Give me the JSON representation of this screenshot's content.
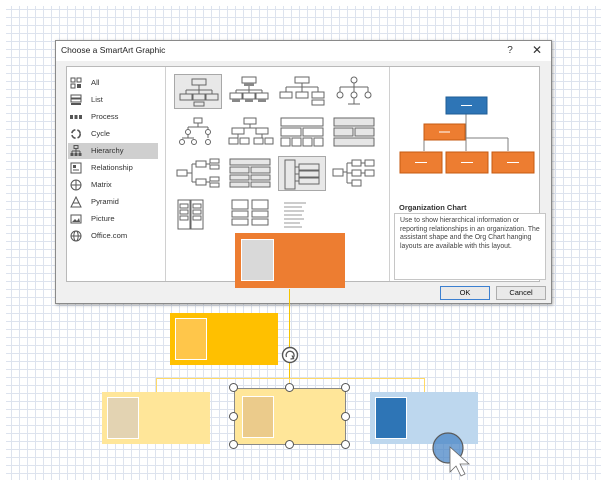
{
  "dialog": {
    "title": "Choose a SmartArt Graphic",
    "help_label": "?",
    "close_label": "✕",
    "ok_label": "OK",
    "cancel_label": "Cancel"
  },
  "categories": [
    {
      "label": "All",
      "icon": "grid-all-icon"
    },
    {
      "label": "List",
      "icon": "list-icon"
    },
    {
      "label": "Process",
      "icon": "process-icon"
    },
    {
      "label": "Cycle",
      "icon": "cycle-icon"
    },
    {
      "label": "Hierarchy",
      "icon": "hierarchy-icon",
      "selected": true
    },
    {
      "label": "Relationship",
      "icon": "relationship-icon"
    },
    {
      "label": "Matrix",
      "icon": "matrix-icon"
    },
    {
      "label": "Pyramid",
      "icon": "pyramid-icon"
    },
    {
      "label": "Picture",
      "icon": "picture-icon"
    },
    {
      "label": "Office.com",
      "icon": "globe-icon"
    }
  ],
  "preview": {
    "title": "Organization Chart",
    "description": "Use to show hierarchical information or reporting relationships in an organization. The assistant shape and the Org Chart hanging layouts are available with this layout."
  },
  "colors": {
    "orange": "#ed7d31",
    "blue": "#2e75b6",
    "gold": "#ffc000",
    "light_gold": "#ffe699",
    "light_blue": "#bdd7ee",
    "dialog_accent": "#3b7fd0"
  }
}
